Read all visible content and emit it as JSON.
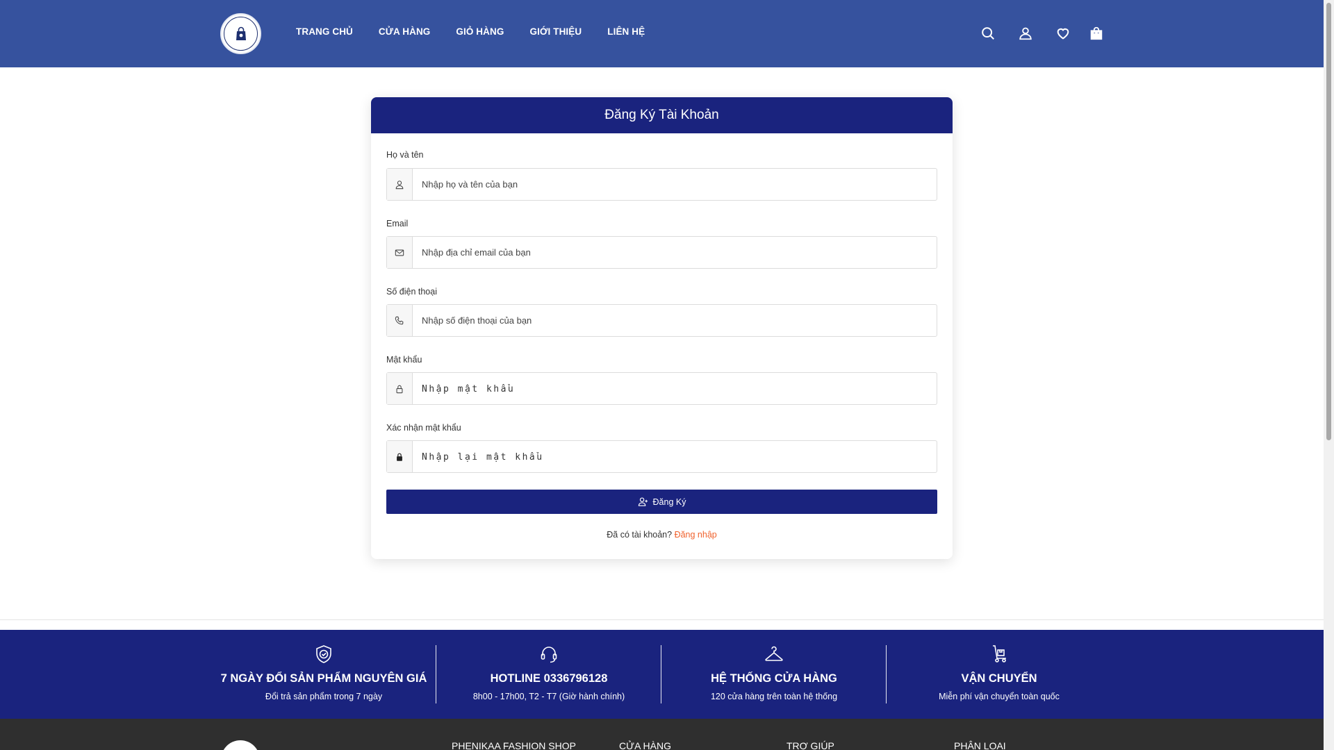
{
  "header": {
    "nav": [
      "TRANG CHỦ",
      "CỬA HÀNG",
      "GIỎ HÀNG",
      "GIỚI THIỆU",
      "LIÊN HỆ"
    ],
    "icons": [
      "search-icon",
      "user-icon",
      "heart-icon",
      "bag-icon"
    ],
    "background": "#36529e"
  },
  "form": {
    "title": "Đăng Ký Tài Khoản",
    "fields": [
      {
        "label": "Họ và tên",
        "placeholder": "Nhập họ và tên của bạn",
        "icon": "user-icon"
      },
      {
        "label": "Email",
        "placeholder": "Nhập địa chỉ email của bạn",
        "icon": "envelope-icon"
      },
      {
        "label": "Số điện thoại",
        "placeholder": "Nhập số điện thoại của bạn",
        "icon": "phone-icon"
      },
      {
        "label": "Mật khẩu",
        "placeholder": "Nhập mật khẩu",
        "icon": "lock-open-icon"
      },
      {
        "label": "Xác nhận mật khẩu",
        "placeholder": "Nhập lại mật khẩu",
        "icon": "lock-icon"
      }
    ],
    "submit_label": "Đăng Ký",
    "login_prompt": "Đã có tài khoản?",
    "login_link": "Đăng nhập",
    "accent": "#1a237e",
    "link_color": "#f0622d"
  },
  "features": [
    {
      "title": "7 NGÀY ĐỔI SẢN PHẨM NGUYÊN GIÁ",
      "subtitle": "Đổi trả sản phẩm trong 7 ngày",
      "icon": "shield-check-icon"
    },
    {
      "title": "HOTLINE 0336796128",
      "subtitle": "8h00 - 17h00, T2 - T7 (Giờ hành chính)",
      "icon": "headset-icon"
    },
    {
      "title": "HỆ THỐNG CỬA HÀNG",
      "subtitle": "120 cửa hàng trên toàn hệ thống",
      "icon": "hanger-icon"
    },
    {
      "title": "VẬN CHUYỂN",
      "subtitle": "Miễn phí vận chuyển toàn quốc",
      "icon": "hand-truck-icon"
    }
  ],
  "footer": {
    "columns": [
      "PHENIKAA FASHION SHOP",
      "CỬA HÀNG",
      "TRỢ GIÚP",
      "PHÂN LOẠI"
    ]
  }
}
